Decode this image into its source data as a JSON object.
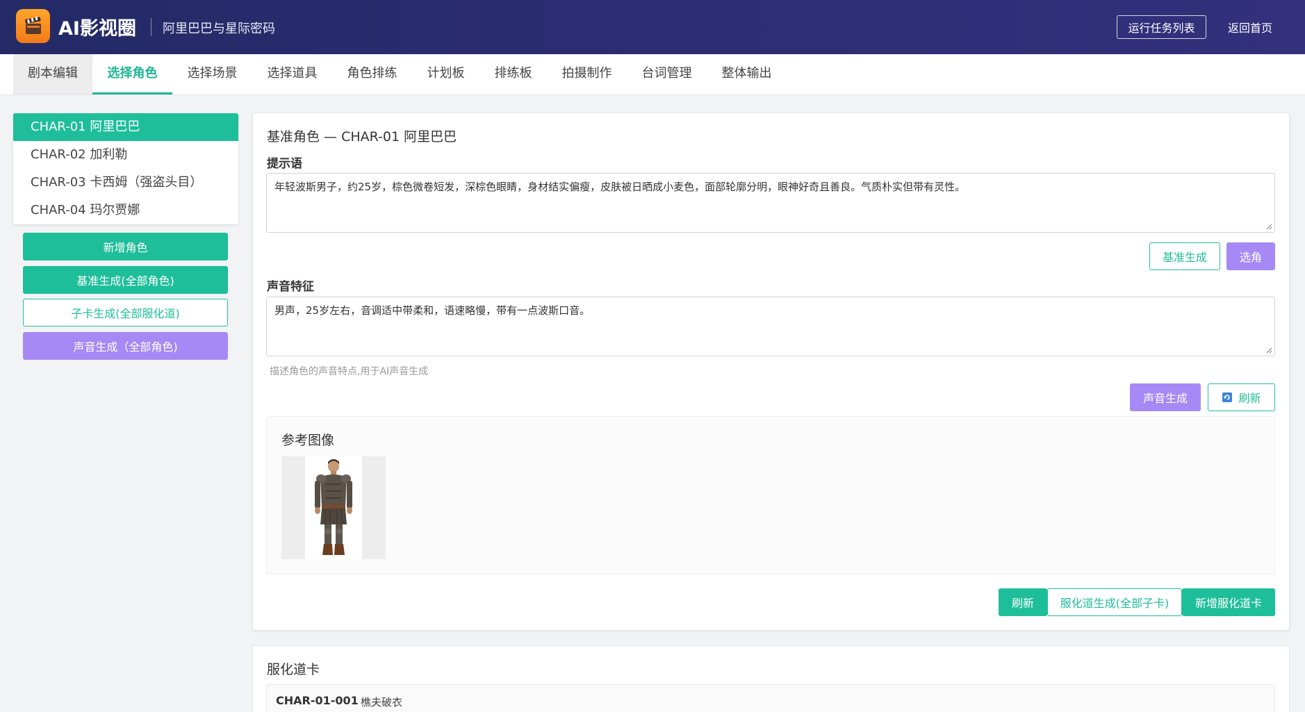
{
  "header": {
    "app_title": "AI影视圈",
    "project_name": "阿里巴巴与星际密码",
    "tasks_button": "运行任务列表",
    "home_link": "返回首页"
  },
  "tabs": [
    {
      "label": "剧本编辑"
    },
    {
      "label": "选择角色"
    },
    {
      "label": "选择场景"
    },
    {
      "label": "选择道具"
    },
    {
      "label": "角色排练"
    },
    {
      "label": "计划板"
    },
    {
      "label": "排练板"
    },
    {
      "label": "拍摄制作"
    },
    {
      "label": "台词管理"
    },
    {
      "label": "整体输出"
    }
  ],
  "active_tab": "选择角色",
  "sidebar": {
    "characters": [
      {
        "label": "CHAR-01 阿里巴巴"
      },
      {
        "label": "CHAR-02 加利勒"
      },
      {
        "label": "CHAR-03 卡西姆（强盗头目）"
      },
      {
        "label": "CHAR-04 玛尔贾娜"
      }
    ],
    "buttons": {
      "add_character": "新增角色",
      "base_generate_all": "基准生成(全部角色)",
      "subcard_generate_all": "子卡生成(全部服化道)",
      "voice_generate_all": "声音生成（全部角色)"
    }
  },
  "main": {
    "title": "基准角色 — CHAR-01 阿里巴巴",
    "prompt_label": "提示语",
    "prompt_value": "年轻波斯男子，约25岁，棕色微卷短发，深棕色眼睛，身材结实偏瘦，皮肤被日晒成小麦色，面部轮廓分明，眼神好奇且善良。气质朴实但带有灵性。",
    "base_generate_button": "基准生成",
    "select_role_button": "选角",
    "voice_label": "声音特征",
    "voice_value": "男声，25岁左右，音调适中带柔和，语速略慢，带有一点波斯口音。",
    "voice_help": "描述角色的声音特点,用于AI声音生成",
    "voice_generate_button": "声音生成",
    "refresh_button": "刷新",
    "reference_title": "参考图像",
    "bottom_refresh_button": "刷新",
    "costume_generate_button": "服化道生成(全部子卡)",
    "add_costume_button": "新增服化道卡"
  },
  "costume_section": {
    "title": "服化道卡",
    "items": [
      {
        "id": "CHAR-01-001",
        "name": "樵夫破衣"
      }
    ]
  },
  "colors": {
    "accent_green": "#1fbe9a",
    "accent_purple": "#a689f5",
    "header_bg": "#2d2d74",
    "logo_orange": "#f7901e"
  }
}
